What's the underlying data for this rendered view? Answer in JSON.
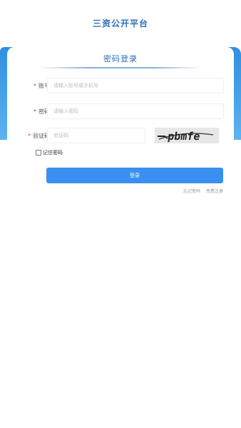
{
  "app": {
    "title": "三资公开平台"
  },
  "login": {
    "title": "密码登录",
    "account": {
      "label": "账号",
      "placeholder": "请输入账号或手机号"
    },
    "password": {
      "label": "密码",
      "placeholder": "请输入密码"
    },
    "captcha": {
      "label": "验证码",
      "placeholder": "验证码",
      "image_text": "pbmfe"
    },
    "remember_label": "记住密码",
    "submit_label": "登录",
    "forgot_link": "忘记密码",
    "register_link": "免费注册"
  },
  "colors": {
    "brand": "#2b6fb8",
    "button": "#3a8ff0",
    "required": "#e23c3c",
    "side_band": "#2f8fe0"
  }
}
